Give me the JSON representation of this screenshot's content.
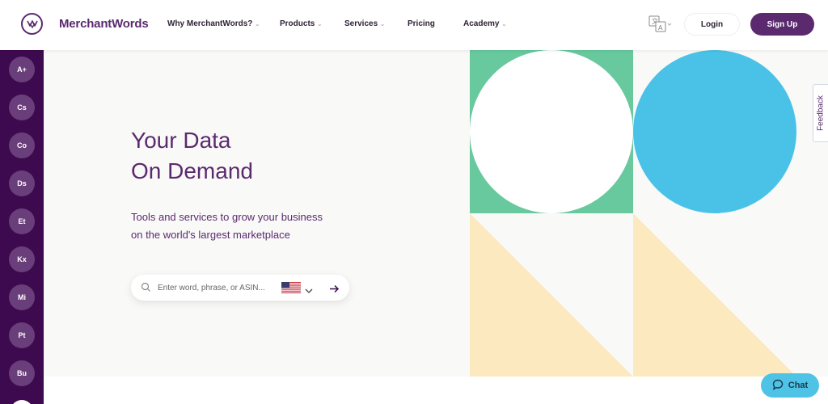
{
  "brand": {
    "name": "MerchantWords"
  },
  "nav": [
    {
      "label": "Why MerchantWords?",
      "has_dropdown": true
    },
    {
      "label": "Products",
      "has_dropdown": true
    },
    {
      "label": "Services",
      "has_dropdown": true
    },
    {
      "label": "Pricing",
      "has_dropdown": false
    },
    {
      "label": "Academy",
      "has_dropdown": true
    }
  ],
  "header": {
    "login_label": "Login",
    "signup_label": "Sign Up",
    "language_icon": "translate-icon"
  },
  "sidebar": {
    "items": [
      "A+",
      "Cs",
      "Co",
      "Ds",
      "Et",
      "Kx",
      "Mi",
      "Pt",
      "Bu"
    ]
  },
  "hero": {
    "title_line1": "Your Data",
    "title_line2": "On Demand",
    "subtitle_line1": "Tools and services to grow your business",
    "subtitle_line2": "on the world's largest marketplace"
  },
  "search": {
    "placeholder": "Enter word, phrase, or ASIN...",
    "value": "",
    "country_icon": "us-flag-icon"
  },
  "feedback": {
    "label": "Feedback"
  },
  "chat": {
    "label": "Chat"
  },
  "colors": {
    "brand_purple": "#5b2a6e",
    "sidebar_bg": "#3e0a4f",
    "green": "#67c99d",
    "blue": "#4ac2e8",
    "peach": "#fde9c0",
    "chat_blue": "#4ec3e6"
  }
}
